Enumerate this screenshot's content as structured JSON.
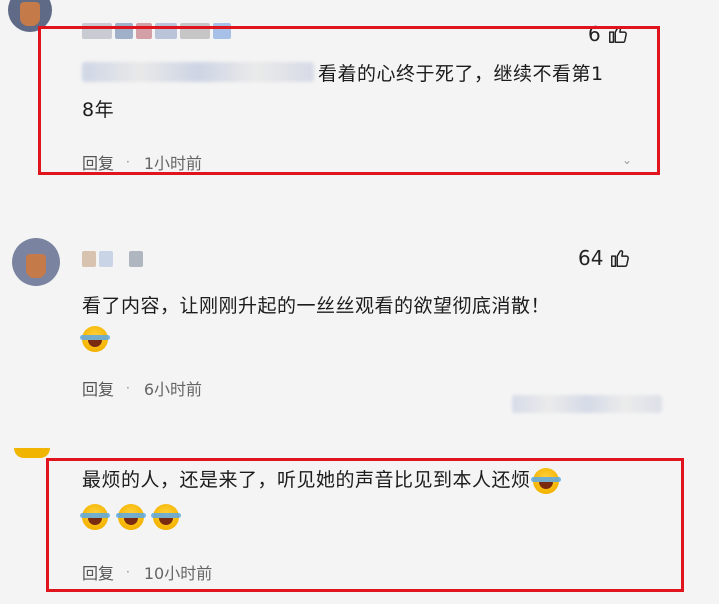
{
  "comments": [
    {
      "likes": "6",
      "text_line1": "看着的心终于死了，继续不看第1",
      "text_line2": "8年",
      "reply_label": "回复",
      "dot": "·",
      "time": "1小时前"
    },
    {
      "likes": "64",
      "text_line1": "看了内容，让刚刚升起的一丝丝观看的欲望彻底消散！",
      "reply_label": "回复",
      "dot": "·",
      "time": "6小时前"
    },
    {
      "text_line1": "最烦的人，还是来了，听见她的声音比见到本人还烦",
      "reply_label": "回复",
      "dot": "·",
      "time": "10小时前"
    }
  ],
  "icons": {
    "thumb": "thumbs-up-icon",
    "emoji": "laughing-crying-emoji-icon"
  },
  "colors": {
    "highlight": "#e0141c",
    "background": "#f4f4f4"
  }
}
